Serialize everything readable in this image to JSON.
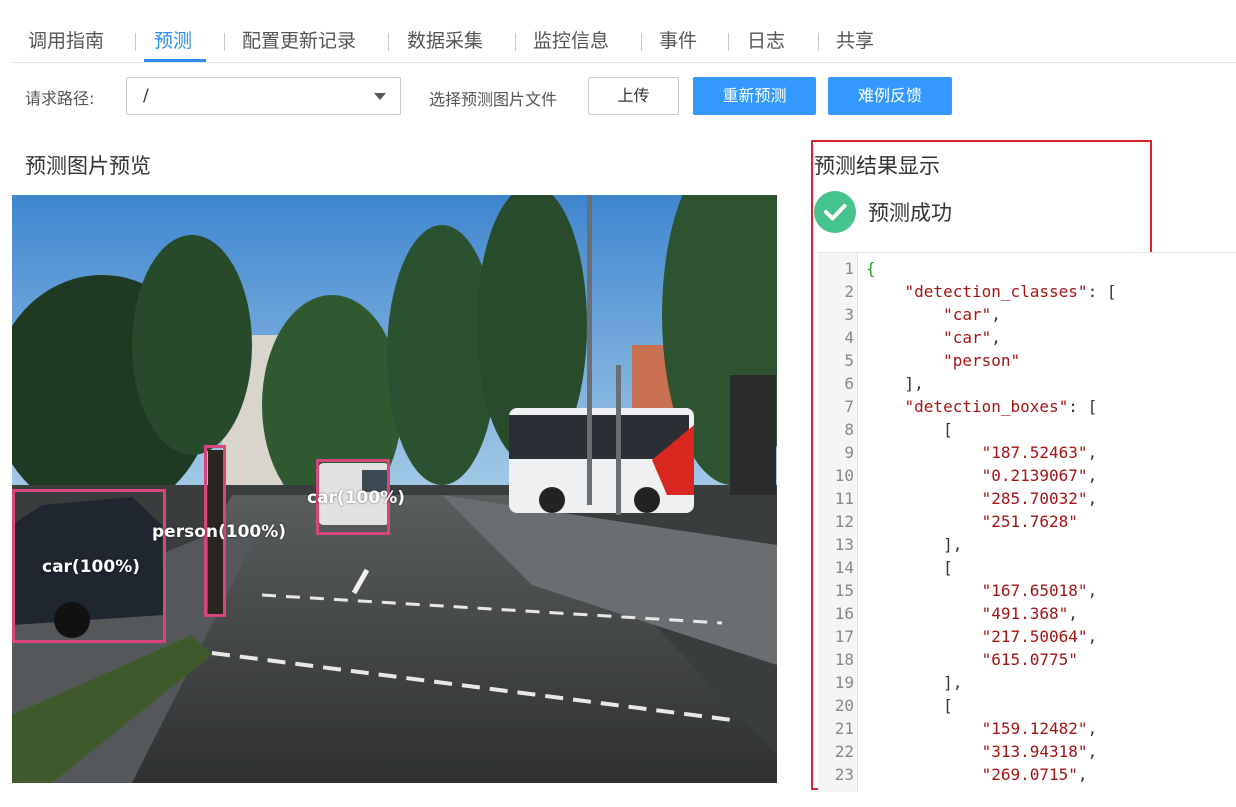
{
  "tabs": [
    "调用指南",
    "预测",
    "配置更新记录",
    "数据采集",
    "监控信息",
    "事件",
    "日志",
    "共享"
  ],
  "active_tab": "预测",
  "toolbar": {
    "request_path_label": "请求路径:",
    "request_path_value": "/",
    "choose_file_label": "选择预测图片文件",
    "upload_label": "上传",
    "repredict_label": "重新预测",
    "feedback_label": "难例反馈"
  },
  "preview": {
    "title": "预测图片预览",
    "detections": [
      "car(100%)",
      "person(100%)",
      "car(100%)"
    ]
  },
  "result": {
    "title": "预测结果显示",
    "status": "预测成功",
    "status_color": "#45c490",
    "code_lines": [
      "{",
      "    \"detection_classes\": [",
      "        \"car\",",
      "        \"car\",",
      "        \"person\"",
      "    ],",
      "    \"detection_boxes\": [",
      "        [",
      "            \"187.52463\",",
      "            \"0.2139067\",",
      "            \"285.70032\",",
      "            \"251.7628\"",
      "        ],",
      "        [",
      "            \"167.65018\",",
      "            \"491.368\",",
      "            \"217.50064\",",
      "            \"615.0775\"",
      "        ],",
      "        [",
      "            \"159.12482\",",
      "            \"313.94318\",",
      "            \"269.0715\","
    ]
  },
  "colors": {
    "accent": "#2d8cf0",
    "button_blue": "#3399ff",
    "box": "#d8457a",
    "panel_border": "#d9232d"
  }
}
